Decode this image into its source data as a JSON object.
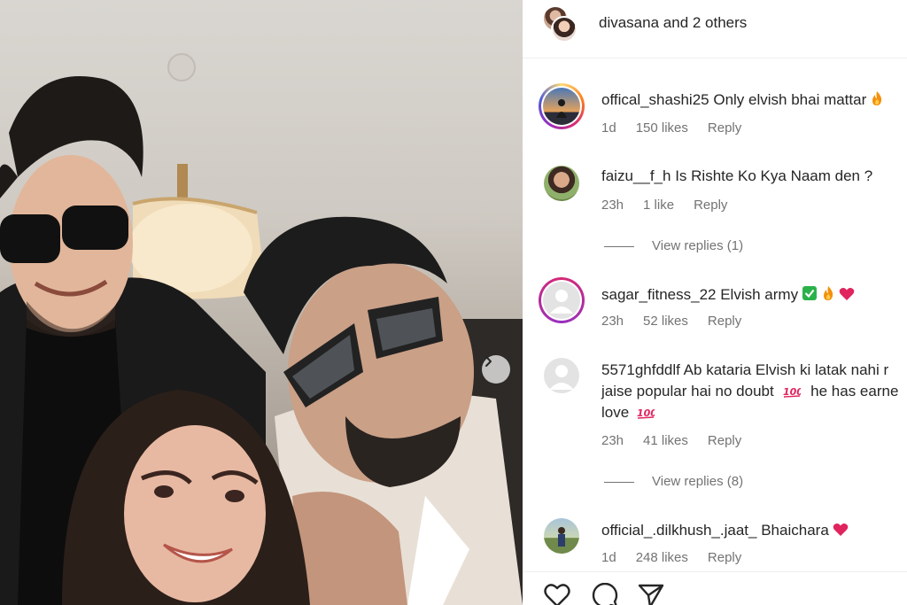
{
  "header": {
    "user": "divasana",
    "rest": " and 2 others"
  },
  "comments": [
    {
      "username": "offical_shashi25",
      "text": "Only elvish bhai mattar",
      "time": "1d",
      "likes": "150 likes",
      "reply": "Reply"
    },
    {
      "username": "faizu__f_h",
      "text": "Is Rishte Ko Kya Naam den ?",
      "time": "23h",
      "likes": "1 like",
      "reply": "Reply",
      "view_replies": "View replies (1)"
    },
    {
      "username": "sagar_fitness_22",
      "text": "Elvish army",
      "time": "23h",
      "likes": "52 likes",
      "reply": "Reply"
    },
    {
      "username": "5571ghfddlf",
      "text": "Ab kataria Elvish ki latak nahi r",
      "line2": "jaise popular hai no doubt",
      "line2b": "he has earne",
      "line3": "love",
      "time": "23h",
      "likes": "41 likes",
      "reply": "Reply",
      "view_replies": "View replies (8)"
    },
    {
      "username": "official_.dilkhush_.jaat_",
      "text": "Bhaichara",
      "time": "1d",
      "likes": "248 likes",
      "reply": "Reply"
    }
  ],
  "icons": {
    "like": "heart-outline-icon",
    "comment": "comment-bubble-icon",
    "share": "paper-plane-icon",
    "next": "chevron-right-icon"
  },
  "colors": {
    "muted_text": "#737373",
    "red_heart": "#e0245e",
    "check_green": "#2ab24a",
    "fire": "#f4900c"
  }
}
